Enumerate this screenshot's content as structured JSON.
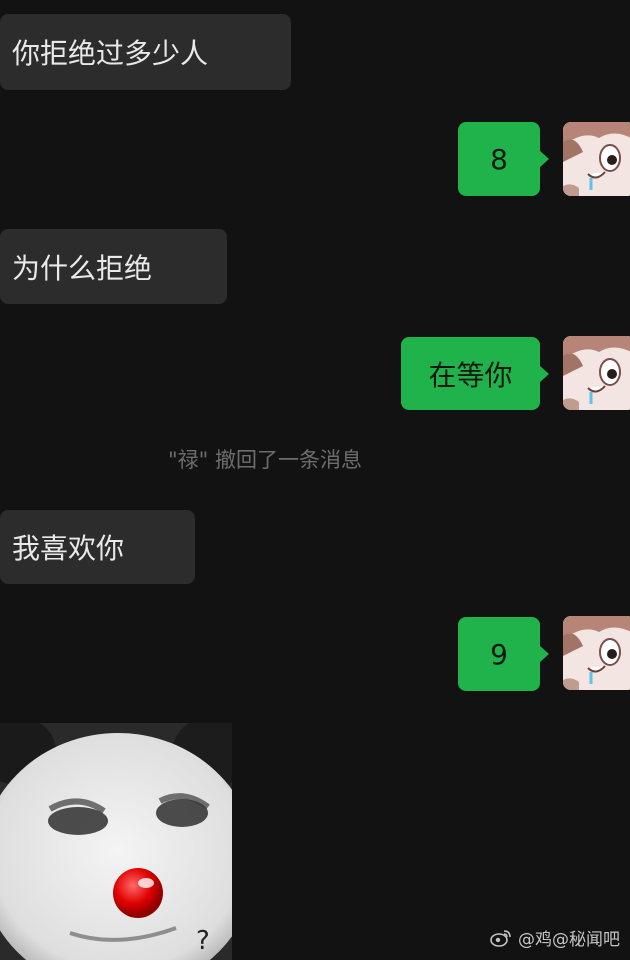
{
  "chat": {
    "messages": [
      {
        "side": "in",
        "text": "你拒绝过多少人"
      },
      {
        "side": "out",
        "text": "8"
      },
      {
        "side": "in",
        "text": "为什么拒绝"
      },
      {
        "side": "out",
        "text": "在等你"
      },
      {
        "side": "system",
        "text": "\"禄\" 撤回了一条消息"
      },
      {
        "side": "in",
        "text": "我喜欢你"
      },
      {
        "side": "out",
        "text": "9"
      }
    ]
  },
  "sticker": {
    "label": "?"
  },
  "watermark": {
    "text": "@鸡@秘闻吧"
  },
  "colors": {
    "background": "#121212",
    "incoming": "#2c2c2c",
    "outgoing": "#21b34b"
  }
}
